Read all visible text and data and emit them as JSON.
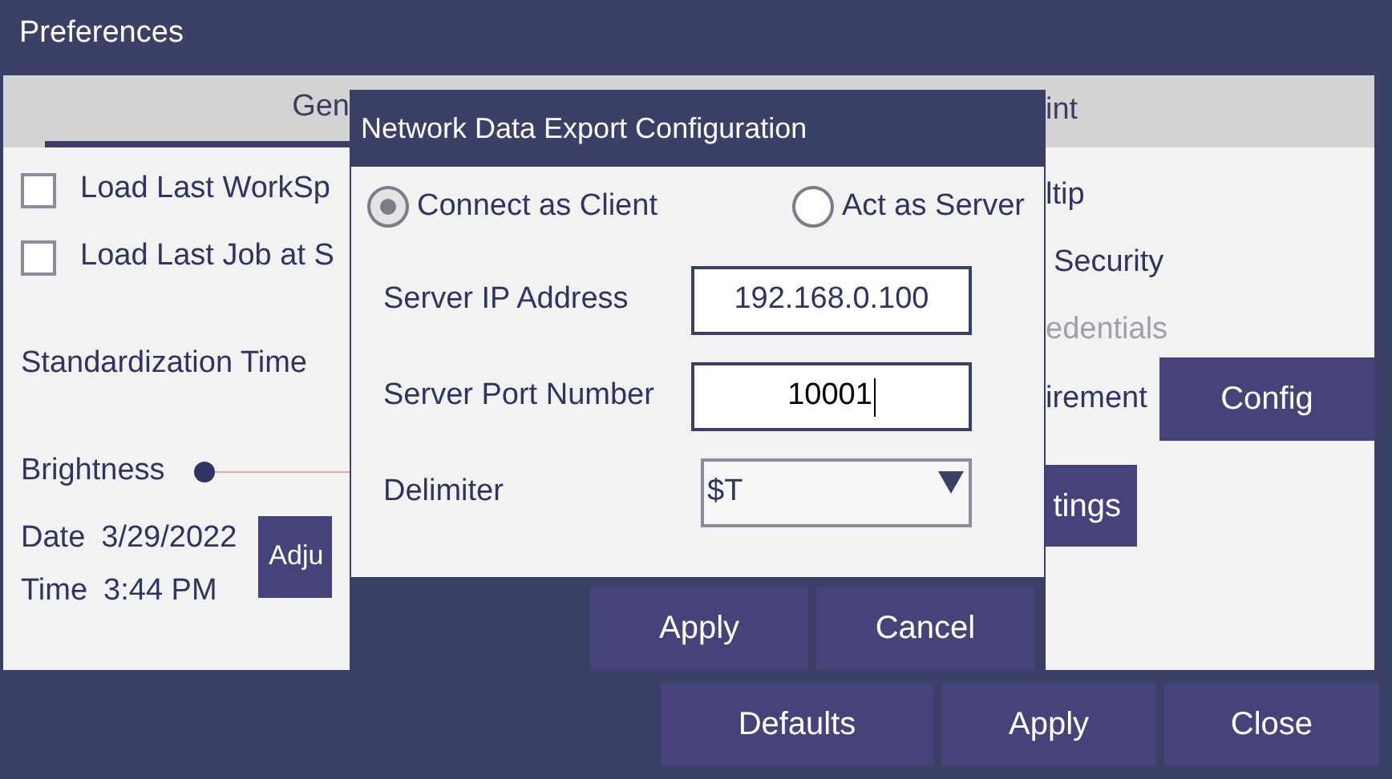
{
  "window": {
    "title": "Preferences"
  },
  "tabs": [
    {
      "label": "Gen",
      "selected": true
    },
    {
      "label": "int",
      "selected": false
    }
  ],
  "left": {
    "checkboxes": [
      {
        "label": "Load Last WorkSp",
        "checked": false
      },
      {
        "label": "Load Last Job at S",
        "checked": false
      }
    ],
    "standardization_label": "Standardization Time",
    "brightness": {
      "label": "Brightness",
      "level": 0
    },
    "date": {
      "label": "Date",
      "value": "3/29/2022"
    },
    "time": {
      "label": "Time",
      "value": "3:44 PM"
    },
    "adjust_button": "Adju"
  },
  "right": {
    "items": [
      {
        "kind": "text",
        "label": "ltip",
        "disabled": false
      },
      {
        "kind": "text",
        "label": "Security",
        "disabled": false
      },
      {
        "kind": "text",
        "label": "edentials",
        "disabled": true
      },
      {
        "kind": "button_row",
        "label": "irement",
        "button": "Config"
      },
      {
        "kind": "button",
        "label": "tings"
      }
    ]
  },
  "dialog": {
    "title": "Network Data Export Configuration",
    "modes": [
      {
        "label": "Connect as Client",
        "selected": true
      },
      {
        "label": "Act as Server",
        "selected": false
      }
    ],
    "fields": [
      {
        "kind": "input",
        "label": "Server IP Address",
        "value": "192.168.0.100",
        "focused": false
      },
      {
        "kind": "input",
        "label": "Server Port Number",
        "value": "10001",
        "focused": true
      },
      {
        "kind": "dropdown",
        "label": "Delimiter",
        "value": "$T"
      }
    ],
    "buttons": [
      "Apply",
      "Cancel"
    ]
  },
  "footer_buttons": [
    "Defaults",
    "Apply",
    "Close"
  ]
}
